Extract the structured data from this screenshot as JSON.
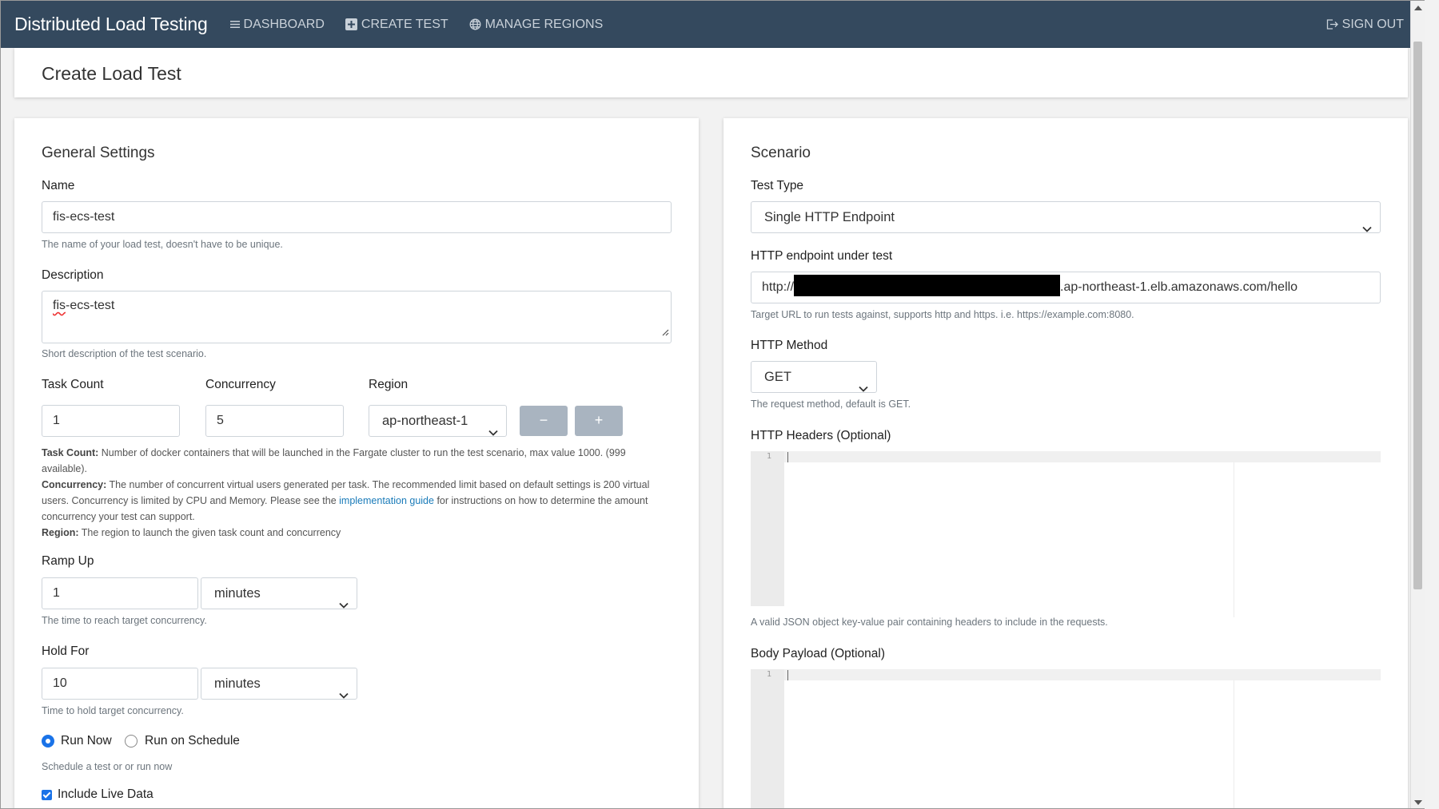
{
  "navbar": {
    "brand": "Distributed Load Testing",
    "dashboard": "DASHBOARD",
    "create_test": "CREATE TEST",
    "manage_regions": "MANAGE REGIONS",
    "sign_out": "SIGN OUT"
  },
  "page": {
    "title": "Create Load Test"
  },
  "general": {
    "heading": "General Settings",
    "name_label": "Name",
    "name_value": "fis-ecs-test",
    "name_help": "The name of your load test, doesn't have to be unique.",
    "desc_label": "Description",
    "desc_value_part1": "fis",
    "desc_value_part2": "-ecs-test",
    "desc_help": "Short description of the test scenario.",
    "task_label": "Task Count",
    "task_value": "1",
    "conc_label": "Concurrency",
    "conc_value": "5",
    "region_label": "Region",
    "region_value": "ap-northeast-1",
    "minus_label": "−",
    "plus_label": "+",
    "task_help_bold": "Task Count:",
    "task_help": " Number of docker containers that will be launched in the Fargate cluster to run the test scenario, max value 1000. (999 available).",
    "conc_help_bold": "Concurrency:",
    "conc_help_1": " The number of concurrent virtual users generated per task. The recommended limit based on default settings is 200 virtual users. Concurrency is limited by CPU and Memory. Please see the ",
    "conc_help_link": "implementation guide",
    "conc_help_2": " for instructions on how to determine the amount concurrency your test can support.",
    "region_help_bold": "Region:",
    "region_help": " The region to launch the given task count and concurrency",
    "ramp_label": "Ramp Up",
    "ramp_value": "1",
    "ramp_unit": "minutes",
    "ramp_help": "The time to reach target concurrency.",
    "hold_label": "Hold For",
    "hold_value": "10",
    "hold_unit": "minutes",
    "hold_help": "Time to hold target concurrency.",
    "run_now": "Run Now",
    "run_schedule": "Run on Schedule",
    "schedule_help": "Schedule a test or or run now",
    "live_data": "Include Live Data"
  },
  "scenario": {
    "heading": "Scenario",
    "type_label": "Test Type",
    "type_value": "Single HTTP Endpoint",
    "endpoint_label": "HTTP endpoint under test",
    "endpoint_prefix": "http://",
    "endpoint_suffix": ".ap-northeast-1.elb.amazonaws.com/hello",
    "endpoint_help": "Target URL to run tests against, supports http and https. i.e. https://example.com:8080.",
    "method_label": "HTTP Method",
    "method_value": "GET",
    "method_help": "The request method, default is GET.",
    "headers_label": "HTTP Headers (Optional)",
    "headers_help": "A valid JSON object key-value pair containing headers to include in the requests.",
    "body_label": "Body Payload (Optional)",
    "line_number": "1"
  }
}
